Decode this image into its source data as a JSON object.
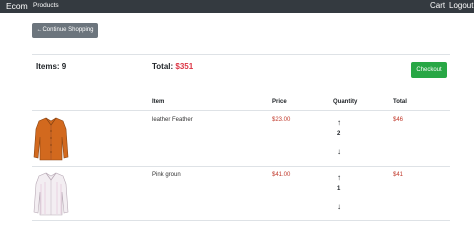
{
  "navbar": {
    "brand": "Ecom",
    "products": "Products",
    "cart": "Cart",
    "logout": "Logout"
  },
  "continue_label": "←Continue Shopping",
  "summary": {
    "items_label": "Items: 9",
    "total_label": "Total: ",
    "total_amount": "$351",
    "checkout_label": "Checkout"
  },
  "table": {
    "headers": {
      "item": "Item",
      "price": "Price",
      "quantity": "Quantity",
      "total": "Total"
    },
    "rows": [
      {
        "name": "leather Feather",
        "price": "$23.00",
        "quantity": "2",
        "total": "$46",
        "image": "orange-shirt"
      },
      {
        "name": "Pink groun",
        "price": "$41.00",
        "quantity": "1",
        "total": "$41",
        "image": "white-shirt"
      }
    ],
    "up_icon": "↑",
    "down_icon": "↓"
  },
  "colors": {
    "navbar": "#343a40",
    "continue": "#6c757d",
    "checkout": "#28a745",
    "total_amount": "#dc3545",
    "price": "#c0392b"
  }
}
